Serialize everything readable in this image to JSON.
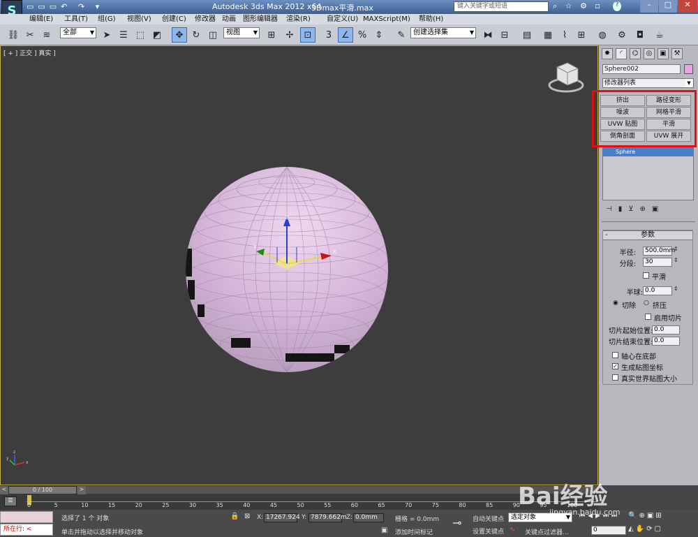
{
  "title_bar": {
    "app_title": "Autodesk 3ds Max  2012 x64",
    "file_title": "3Dmax平滑.max",
    "search_placeholder": "键入关键字或短语"
  },
  "menu": [
    "编辑(E)",
    "工具(T)",
    "组(G)",
    "视图(V)",
    "创建(C)",
    "修改器",
    "动画",
    "图形编辑器",
    "渲染(R)",
    "自定义(U)",
    "MAXScript(M)",
    "帮助(H)"
  ],
  "toolbar": {
    "selection_filter": "全部",
    "ref_coord": "视图",
    "named_selection": "创建选择集"
  },
  "viewport": {
    "label": "[ + ] 正交 ] 真实 ]",
    "gizmo_x": "X",
    "gizmo_y": "Y",
    "gizmo_z": "Z",
    "axis_tripod_labels": [
      "x",
      "y",
      "z"
    ]
  },
  "command_panel": {
    "object_name": "Sphere002",
    "object_color": "#e6a6e6",
    "modifier_list": "修改器列表",
    "modifier_buttons": [
      "挤出",
      "路径变形",
      "噪波",
      "网格平滑",
      "UVW 贴图",
      "平滑",
      "倒角剖面",
      "UVW 展开"
    ],
    "stack_item": "Sphere",
    "rollout_title": "参数",
    "params": {
      "radius_label": "半径:",
      "radius_value": "500.0mm",
      "segments_label": "分段:",
      "segments_value": "30",
      "smooth_label": "平滑",
      "hemisphere_label": "半球:",
      "hemisphere_value": "0.0",
      "chop_label": "切除",
      "squash_label": "挤压",
      "slice_on_label": "启用切片",
      "slice_from_label": "切片起始位置:",
      "slice_from_value": "0.0",
      "slice_to_label": "切片结束位置:",
      "slice_to_value": "0.0",
      "base_to_pivot_label": "轴心在底部",
      "gen_map_coords_label": "生成贴图坐标",
      "real_world_label": "真实世界贴图大小"
    }
  },
  "timeline": {
    "frame_display": "0 / 100",
    "ticks": [
      "0",
      "5",
      "10",
      "15",
      "20",
      "25",
      "30",
      "35",
      "40",
      "45",
      "50",
      "55",
      "60",
      "65",
      "70",
      "75",
      "80",
      "85",
      "90",
      "95",
      "100"
    ]
  },
  "status": {
    "running_label": "所在行:",
    "selection_info": "选择了 1 个 对象",
    "prompt": "单击并拖动以选择并移动对象",
    "x_label": "X:",
    "x_value": "17267.924",
    "y_label": "Y:",
    "y_value": "7879.662m",
    "z_label": "Z:",
    "z_value": "0.0mm",
    "grid": "栅格 = 0.0mm",
    "add_time_tag": "添加时间标记",
    "auto_key": "自动关键点",
    "set_key": "设置关键点",
    "selected_object": "选定对象",
    "key_filters": "关键点过滤器...",
    "frame_value": "0"
  },
  "watermark": {
    "brand": "Bai经验",
    "url": "jingyan.baidu.com"
  },
  "colors": {
    "highlight_box": "#e01010",
    "sphere": "#d8b8dc",
    "selection_blue": "#4a7cc8"
  }
}
